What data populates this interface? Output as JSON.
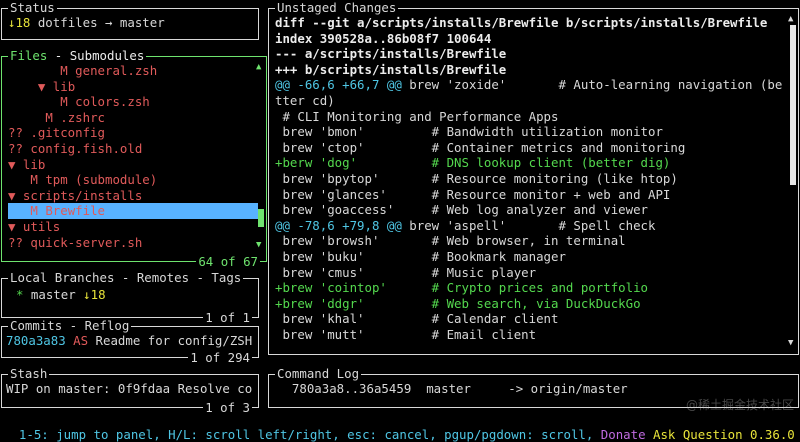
{
  "status": {
    "title": "Status",
    "ahead": "↓18",
    "repo": " dotfiles → master"
  },
  "files": {
    "title": "Files",
    "title_sep": " - ",
    "title_alt": "Submodules",
    "items": [
      {
        "indent": "       ",
        "marker": "M",
        "name": " general.zsh",
        "color": "red"
      },
      {
        "indent": "    ",
        "marker": "▼",
        "name": " lib",
        "color": "red"
      },
      {
        "indent": "       ",
        "marker": "M",
        "name": " colors.zsh",
        "color": "red"
      },
      {
        "indent": "     ",
        "marker": "M",
        "name": " .zshrc",
        "color": "red"
      },
      {
        "indent": "",
        "marker": "??",
        "name": " .gitconfig",
        "color": "red"
      },
      {
        "indent": "",
        "marker": "??",
        "name": " config.fish.old",
        "color": "red"
      },
      {
        "indent": "",
        "marker": "▼",
        "name": " lib",
        "color": "red"
      },
      {
        "indent": "   ",
        "marker": "M",
        "name": " tpm (submodule)",
        "color": "red"
      },
      {
        "indent": "",
        "marker": "▼",
        "name": " scripts/installs",
        "color": "red"
      },
      {
        "indent": "   ",
        "marker": "M",
        "name": " Brewfile",
        "color": "red"
      },
      {
        "indent": "",
        "marker": "▼",
        "name": " utils",
        "color": "red"
      },
      {
        "indent": "",
        "marker": "??",
        "name": " quick-server.sh",
        "color": "red"
      }
    ],
    "selected_index": 9,
    "footer": "64 of 67"
  },
  "branches": {
    "title": "Local Branches",
    "title_rest": " - Remotes - Tags",
    "star": "*",
    "name": " master ",
    "ahead": "↓18",
    "footer": "1 of 1"
  },
  "commits": {
    "title": "Commits",
    "title_rest": " - Reflog",
    "hash": "780a3a83",
    "author": " AS",
    "message": " Readme for config/ZSH",
    "footer": "1 of 294"
  },
  "stash": {
    "title": "Stash",
    "entry": "WIP on master: 0f9fdaa Resolve co",
    "footer": "1 of 3"
  },
  "diff": {
    "title": "Unstaged Changes",
    "lines": [
      {
        "text": "diff --git a/scripts/installs/Brewfile b/scripts/installs/Brewfile",
        "style": "bold white"
      },
      {
        "text": "index 390528a..86b08f7 100644",
        "style": "bold white"
      },
      {
        "text": "--- a/scripts/installs/Brewfile",
        "style": "bold white"
      },
      {
        "text": "+++ b/scripts/installs/Brewfile",
        "style": "bold white"
      },
      {
        "text": "@@ -66,6 +66,7 @@",
        "rest": " brew 'zoxide'       # Auto-learning navigation (be",
        "style": "cyan"
      },
      {
        "text": "tter cd)",
        "style": ""
      },
      {
        "text": " # CLI Monitoring and Performance Apps",
        "style": ""
      },
      {
        "text": " brew 'bmon'         # Bandwidth utilization monitor",
        "style": ""
      },
      {
        "text": " brew 'ctop'         # Container metrics and monitoring",
        "style": ""
      },
      {
        "text": "+berw 'dog'          # DNS lookup client (better dig)",
        "style": "green"
      },
      {
        "text": " brew 'bpytop'       # Resource monitoring (like htop)",
        "style": ""
      },
      {
        "text": " brew 'glances'      # Resource monitor + web and API",
        "style": ""
      },
      {
        "text": " brew 'goaccess'     # Web log analyzer and viewer",
        "style": ""
      },
      {
        "text": "@@ -78,6 +79,8 @@",
        "rest": " brew 'aspell'       # Spell check",
        "style": "cyan"
      },
      {
        "text": " brew 'browsh'       # Web browser, in terminal",
        "style": ""
      },
      {
        "text": " brew 'buku'         # Bookmark manager",
        "style": ""
      },
      {
        "text": " brew 'cmus'         # Music player",
        "style": ""
      },
      {
        "text": "+brew 'cointop'      # Crypto prices and portfolio",
        "style": "green"
      },
      {
        "text": "+brew 'ddgr'         # Web search, via DuckDuckGo",
        "style": "green"
      },
      {
        "text": " brew 'khal'         # Calendar client",
        "style": ""
      },
      {
        "text": " brew 'mutt'         # Email client",
        "style": ""
      }
    ]
  },
  "command_log": {
    "title": "Command Log",
    "entry": "  780a3a8..36a5459  master     -> origin/master"
  },
  "bottom_bar": {
    "help": "1-5: jump to panel, H/L: scroll left/right, esc: cancel, pgup/pgdown: scroll,",
    "donate": " Donate",
    "ask": " Ask Question",
    "version": " 0.36.0",
    "watermark": "@稀土掘金技术社区"
  }
}
